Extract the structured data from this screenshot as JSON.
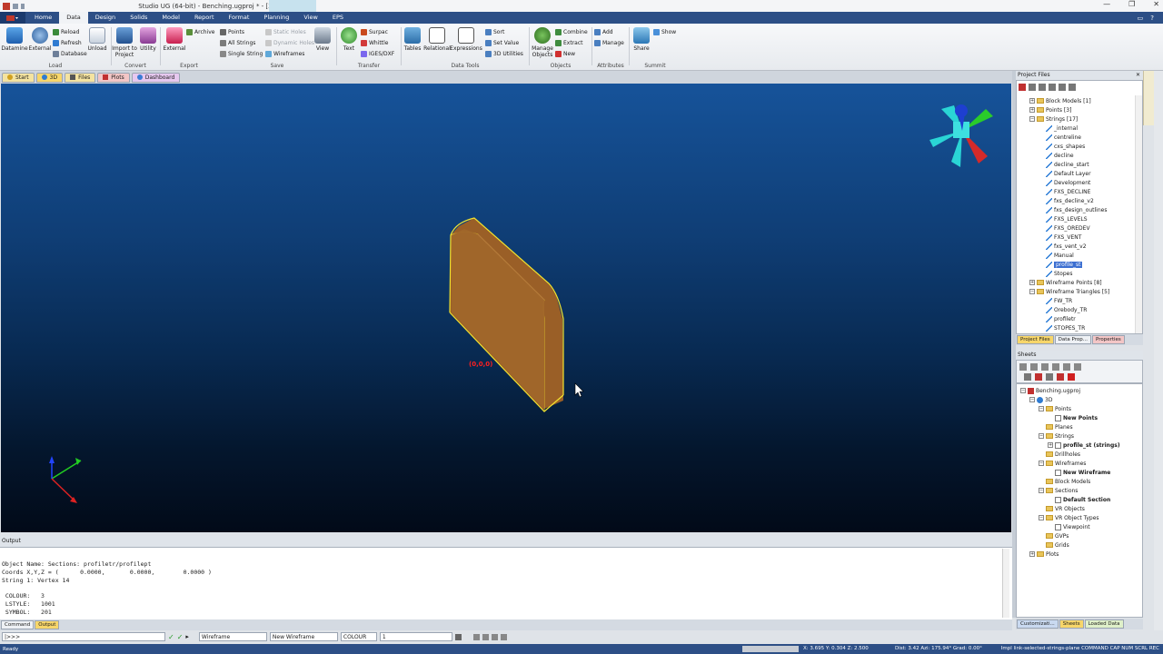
{
  "window": {
    "title": "Studio UG (64-bit) - Benching.ugproj * - [3D]",
    "controls": [
      "—",
      "❐",
      "✕"
    ]
  },
  "menu": {
    "tabs": [
      "Home",
      "Data",
      "Design",
      "Solids",
      "Model",
      "Report",
      "Format",
      "Planning",
      "View",
      "EPS"
    ],
    "active": "Data"
  },
  "ribbon": {
    "load": {
      "label": "Load",
      "datamine": "Datamine",
      "external": "External",
      "reload": "Reload",
      "refresh": "Refresh",
      "database": "Database",
      "unload": "Unload"
    },
    "convert": {
      "label": "Convert",
      "import_to_project": "Import to Project",
      "utility": "Utility"
    },
    "export": {
      "label": "Export",
      "external": "External"
    },
    "save": {
      "label": "Save",
      "archive": "Archive",
      "points": "Points",
      "all_strings": "All Strings",
      "single_string": "Single String",
      "static_holes": "Static Holes",
      "dynamic_holes": "Dynamic Holes",
      "wireframes": "Wireframes",
      "view": "View"
    },
    "transfer": {
      "label": "Transfer",
      "text": "Text",
      "surpac": "Surpac",
      "whittle": "Whittle",
      "iges_dxf": "IGES/DXF"
    },
    "data_tools": {
      "label": "Data Tools",
      "tables": "Tables",
      "relational": "Relational",
      "expressions": "Expressions",
      "sort": "Sort",
      "set_value": "Set Value",
      "utilities_3d": "3D Utilities"
    },
    "objects": {
      "label": "Objects",
      "manage_objects": "Manage Objects",
      "combine": "Combine",
      "extract": "Extract",
      "new": "New"
    },
    "attributes": {
      "label": "Attributes",
      "add": "Add",
      "manage": "Manage"
    },
    "summit": {
      "label": "Summit",
      "share": "Share",
      "show": "Show"
    }
  },
  "doc_tabs": [
    "Start",
    "3D",
    "Files",
    "Plots",
    "Dashboard"
  ],
  "viewport": {
    "origin_label": "(0,0,0)"
  },
  "project_files": {
    "title": "Project Files",
    "items": [
      {
        "label": "Block Models [1]",
        "level": 1,
        "kind": "folder",
        "exp": "+"
      },
      {
        "label": "Points [3]",
        "level": 1,
        "kind": "folder",
        "exp": "+"
      },
      {
        "label": "Strings [17]",
        "level": 1,
        "kind": "folder",
        "exp": "−"
      },
      {
        "label": "_internal",
        "level": 2,
        "kind": "string"
      },
      {
        "label": "centreline",
        "level": 2,
        "kind": "string"
      },
      {
        "label": "cxs_shapes",
        "level": 2,
        "kind": "string"
      },
      {
        "label": "decline",
        "level": 2,
        "kind": "string"
      },
      {
        "label": "decline_start",
        "level": 2,
        "kind": "string"
      },
      {
        "label": "Default Layer",
        "level": 2,
        "kind": "string"
      },
      {
        "label": "Development",
        "level": 2,
        "kind": "string"
      },
      {
        "label": "FXS_DECLINE",
        "level": 2,
        "kind": "string"
      },
      {
        "label": "fxs_decline_v2",
        "level": 2,
        "kind": "string"
      },
      {
        "label": "fxs_design_outlines",
        "level": 2,
        "kind": "string"
      },
      {
        "label": "FXS_LEVELS",
        "level": 2,
        "kind": "string"
      },
      {
        "label": "FXS_OREDEV",
        "level": 2,
        "kind": "string"
      },
      {
        "label": "FXS_VENT",
        "level": 2,
        "kind": "string"
      },
      {
        "label": "fxs_vent_v2",
        "level": 2,
        "kind": "string"
      },
      {
        "label": "Manual",
        "level": 2,
        "kind": "string"
      },
      {
        "label": "profile_st",
        "level": 2,
        "kind": "string",
        "selected": true
      },
      {
        "label": "Stopes",
        "level": 2,
        "kind": "string"
      },
      {
        "label": "Wireframe Points [8]",
        "level": 1,
        "kind": "folder",
        "exp": "+"
      },
      {
        "label": "Wireframe Triangles [5]",
        "level": 1,
        "kind": "folder",
        "exp": "−"
      },
      {
        "label": "FW_TR",
        "level": 2,
        "kind": "string"
      },
      {
        "label": "Orebody_TR",
        "level": 2,
        "kind": "string"
      },
      {
        "label": "profiletr",
        "level": 2,
        "kind": "string"
      },
      {
        "label": "STOPES_TR",
        "level": 2,
        "kind": "string"
      }
    ],
    "tabs": [
      "Project Files",
      "Data Prop...",
      "Properties"
    ]
  },
  "sheets": {
    "title": "Sheets",
    "items": [
      {
        "label": "Benching.ugproj",
        "level": 0,
        "kind": "root",
        "exp": "−"
      },
      {
        "label": "3D",
        "level": 1,
        "kind": "globe",
        "exp": "−"
      },
      {
        "label": "Points",
        "level": 2,
        "kind": "folder",
        "exp": "−"
      },
      {
        "label": "New Points",
        "level": 3,
        "kind": "item",
        "bold": true
      },
      {
        "label": "Planes",
        "level": 2,
        "kind": "folder"
      },
      {
        "label": "Strings",
        "level": 2,
        "kind": "folder",
        "exp": "−"
      },
      {
        "label": "profile_st (strings)",
        "level": 3,
        "kind": "item",
        "bold": true,
        "exp": "+"
      },
      {
        "label": "Drillholes",
        "level": 2,
        "kind": "folder"
      },
      {
        "label": "Wireframes",
        "level": 2,
        "kind": "folder",
        "exp": "−"
      },
      {
        "label": "New Wireframe",
        "level": 3,
        "kind": "item",
        "bold": true
      },
      {
        "label": "Block Models",
        "level": 2,
        "kind": "folder"
      },
      {
        "label": "Sections",
        "level": 2,
        "kind": "folder",
        "exp": "−"
      },
      {
        "label": "Default Section",
        "level": 3,
        "kind": "item",
        "bold": true
      },
      {
        "label": "VR Objects",
        "level": 2,
        "kind": "folder"
      },
      {
        "label": "VR Object Types",
        "level": 2,
        "kind": "folder",
        "exp": "−"
      },
      {
        "label": "Viewpoint",
        "level": 3,
        "kind": "item"
      },
      {
        "label": "GVPs",
        "level": 2,
        "kind": "folder"
      },
      {
        "label": "Grids",
        "level": 2,
        "kind": "folder"
      },
      {
        "label": "Plots",
        "level": 1,
        "kind": "folder",
        "exp": "+"
      }
    ],
    "tabs": [
      "Customizati...",
      "Sheets",
      "Loaded Data"
    ]
  },
  "output": {
    "title": "Output",
    "lines": [
      "Object Name: Sections: profiletr/profilept",
      "Coords X,Y,Z = (      0.0000,       0.0000,        0.0000 )",
      "String 1: Vertex 14",
      "",
      " COLOUR:   3",
      " LSTYLE:   1001",
      " SYMBOL:   201"
    ],
    "tabs": [
      "Command",
      "Output"
    ]
  },
  "command_bar": {
    "prompt": "|>>>",
    "object_type": "Wireframe",
    "object_name": "New Wireframe",
    "attribute": "COLOUR",
    "value": "1"
  },
  "status": {
    "ready": "Ready",
    "xyz": "X: 3.695     Y: 0.304     Z: 2.500",
    "dist": "Dist: 3.42 Azi: 175.94° Grad: 0.00°",
    "right": "Impl link-selected-strings-plane  COMMAND  CAP  NUM  SCRL  REC"
  },
  "colors": {
    "accent": "#2d4f86",
    "solid_fill": "#a0662a",
    "solid_edge": "#f2e22e",
    "origin_label": "#ff1f1f"
  }
}
